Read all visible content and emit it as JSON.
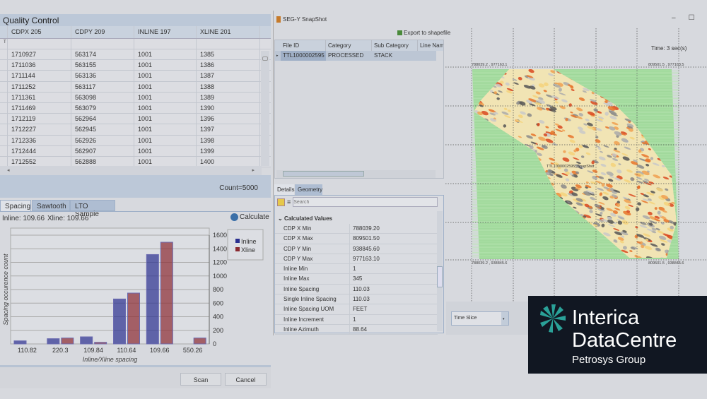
{
  "quality_control": {
    "title": "Quality Control",
    "columns": [
      "CDPX 205",
      "CDPY 209",
      "INLINE 197",
      "XLINE 201"
    ],
    "rows": [
      [
        "1710927",
        "563174",
        "1001",
        "1385"
      ],
      [
        "1711036",
        "563155",
        "1001",
        "1386"
      ],
      [
        "1711144",
        "563136",
        "1001",
        "1387"
      ],
      [
        "1711252",
        "563117",
        "1001",
        "1388"
      ],
      [
        "1711361",
        "563098",
        "1001",
        "1389"
      ],
      [
        "1711469",
        "563079",
        "1001",
        "1390"
      ],
      [
        "1712119",
        "562964",
        "1001",
        "1396"
      ],
      [
        "1712227",
        "562945",
        "1001",
        "1397"
      ],
      [
        "1712336",
        "562926",
        "1001",
        "1398"
      ],
      [
        "1712444",
        "562907",
        "1001",
        "1399"
      ],
      [
        "1712552",
        "562888",
        "1001",
        "1400"
      ]
    ],
    "count": "Count=5000",
    "tabs": [
      "Spacing",
      "Sawtooth",
      "LTO Sample"
    ],
    "inline_value": "Inline: 109.66",
    "xline_value": "Xline: 109.66",
    "calculate_label": "Calculate",
    "scan_label": "Scan",
    "cancel_label": "Cancel"
  },
  "chart_data": {
    "type": "bar",
    "categories": [
      "110.82",
      "220.3",
      "109.84",
      "110.64",
      "109.66",
      "550.26"
    ],
    "series": [
      {
        "name": "Inline",
        "values": [
          45,
          77,
          104,
          661,
          1315,
          0
        ],
        "color": "#2a2f8f"
      },
      {
        "name": "Xline",
        "values": [
          0,
          87,
          24,
          748,
          1496,
          87
        ],
        "color": "#8a2a30"
      }
    ],
    "xlabel": "Inline/Xline spacing",
    "ylabel": "Spacing occurence count",
    "ylim": [
      0,
      1600
    ],
    "yticks": [
      "0",
      "200",
      "400",
      "600",
      "800",
      "1000",
      "1200",
      "1400",
      "1600"
    ],
    "grid": true,
    "legend": "top-right"
  },
  "snapshot": {
    "title": "SEG-Y SnapShot",
    "export_label": "Export to shapefile",
    "columns": [
      "File ID",
      "Category",
      "Sub Category",
      "Line Nam"
    ],
    "rows": [
      [
        "TTL1000002595",
        "PROCESSED",
        "STACK",
        ""
      ]
    ],
    "tabs": [
      "Details",
      "Geometry"
    ],
    "search_placeholder": "Search",
    "section": "Calculated Values",
    "properties": [
      [
        "CDP X Min",
        "788039.20"
      ],
      [
        "CDP X Max",
        "809501.50"
      ],
      [
        "CDP Y Min",
        "938845.60"
      ],
      [
        "CDP Y Max",
        "977163.10"
      ],
      [
        "Inline Min",
        "1"
      ],
      [
        "Inline Max",
        "345"
      ],
      [
        "Inline Spacing",
        "110.03"
      ],
      [
        "Single Inline Spacing",
        "110.03"
      ],
      [
        "Inline Spacing UOM",
        "FEET"
      ],
      [
        "Inline Increment",
        "1"
      ],
      [
        "Inline Azimuth",
        "88.64"
      ]
    ]
  },
  "map": {
    "time_label": "Time: 3 sec(s)",
    "corners": [
      "788039.2 , 977163.1",
      "809501.5 , 977163.5",
      "788039.2 , 938845.6",
      "809501.5 , 938845.6"
    ],
    "survey_label": "TTL1000002595_SnapShot",
    "mode_select": "Time Slice"
  },
  "logo": {
    "line1": "Interica",
    "line2": "DataCentre",
    "line3": "Petrosys Group",
    "bg": "#111722",
    "accent": "#2aa198"
  }
}
